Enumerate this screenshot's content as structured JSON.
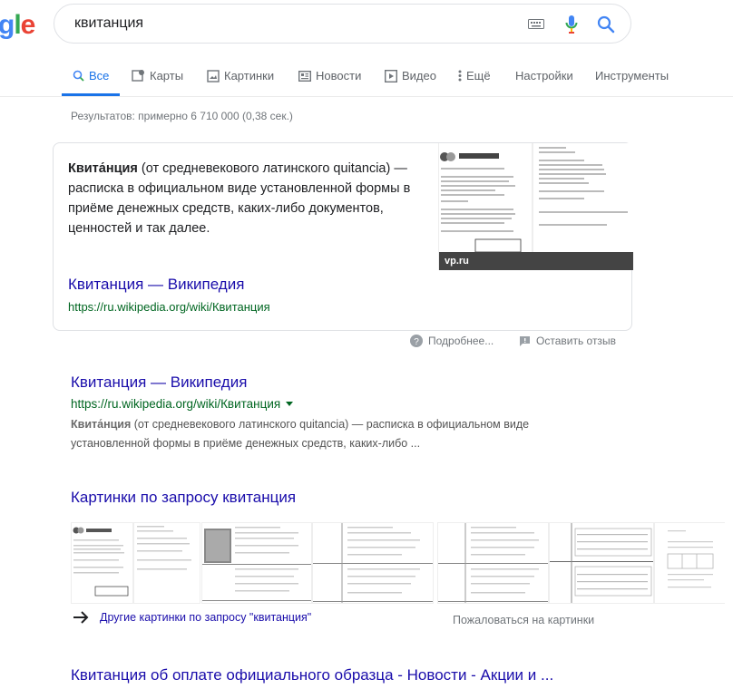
{
  "logo": {
    "text_partial": "gle"
  },
  "search": {
    "query": "квитанция"
  },
  "tabs": [
    {
      "label": "Все",
      "active": true
    },
    {
      "label": "Карты"
    },
    {
      "label": "Картинки"
    },
    {
      "label": "Новости"
    },
    {
      "label": "Видео"
    },
    {
      "label": "Ещё"
    },
    {
      "label": "Настройки"
    },
    {
      "label": "Инструменты"
    }
  ],
  "stats": "Результатов: примерно 6 710 000 (0,38 сек.)",
  "featured": {
    "term": "Квита́нция",
    "definition": " (от средневекового латинского quitancia) — расписка в официальном виде установленной формы в приёме денежных средств, каких-либо документов, ценностей и так далее.",
    "link_title": "Квитанция — Википедия",
    "link_url": "https://ru.wikipedia.org/wiki/Квитанция",
    "thumb_caption": "vp.ru",
    "thumb_brand": "ВсеПлатежи"
  },
  "feedback": {
    "more": "Подробнее...",
    "report": "Оставить отзыв"
  },
  "result": {
    "title": "Квитанция — Википедия",
    "url": "https://ru.wikipedia.org/wiki/Квитанция",
    "snippet_term": "Квита́нция",
    "snippet": " (от средневекового латинского quitancia) — расписка в официальном виде установленной формы в приёме денежных средств, каких-либо ..."
  },
  "images": {
    "title": "Картинки по запросу квитанция",
    "more": "Другие картинки по запросу \"квитанция\"",
    "report": "Пожаловаться на картинки"
  },
  "next_result": {
    "title": "Квитанция об оплате официального образца - Новости - Акции и ..."
  },
  "colors": {
    "link": "#1a0dab",
    "url": "#006621",
    "accent": "#1a73e8"
  }
}
